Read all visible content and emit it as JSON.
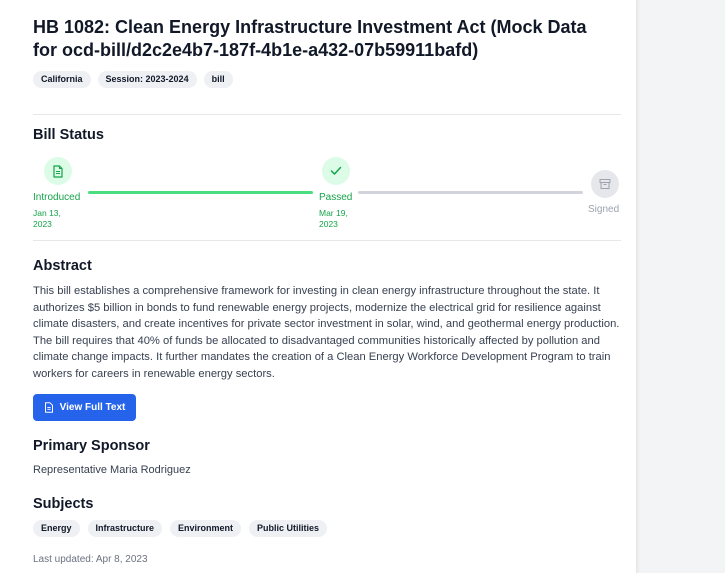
{
  "bill": {
    "title": "HB 1082: Clean Energy Infrastructure Investment Act (Mock Data for ocd-bill/d2c2e4b7-187f-4b1e-a432-07b59911bafd)",
    "badges": [
      "California",
      "Session: 2023-2024",
      "bill"
    ]
  },
  "status": {
    "heading": "Bill Status",
    "steps": [
      {
        "label": "Introduced",
        "date": "Jan 13, 2023",
        "state": "complete",
        "icon": "document-icon"
      },
      {
        "label": "Passed",
        "date": "Mar 19, 2023",
        "state": "complete",
        "icon": "check-icon"
      },
      {
        "label": "Signed",
        "date": "",
        "state": "pending",
        "icon": "archive-icon"
      }
    ]
  },
  "abstract": {
    "heading": "Abstract",
    "text": "This bill establishes a comprehensive framework for investing in clean energy infrastructure throughout the state. It authorizes $5 billion in bonds to fund renewable energy projects, modernize the electrical grid for resilience against climate disasters, and create incentives for private sector investment in solar, wind, and geothermal energy production. The bill requires that 40% of funds be allocated to disadvantaged communities historically affected by pollution and climate change impacts. It further mandates the creation of a Clean Energy Workforce Development Program to train workers for careers in renewable energy sectors.",
    "button_label": "View Full Text"
  },
  "sponsor": {
    "heading": "Primary Sponsor",
    "name": "Representative Maria Rodriguez"
  },
  "subjects": {
    "heading": "Subjects",
    "items": [
      "Energy",
      "Infrastructure",
      "Environment",
      "Public Utilities"
    ]
  },
  "footer": {
    "last_updated": "Last updated: Apr 8, 2023"
  },
  "colors": {
    "accent": "#2563eb",
    "complete": "#16a34a",
    "complete_line": "#4ade80",
    "pending_line": "#d1d5db"
  }
}
